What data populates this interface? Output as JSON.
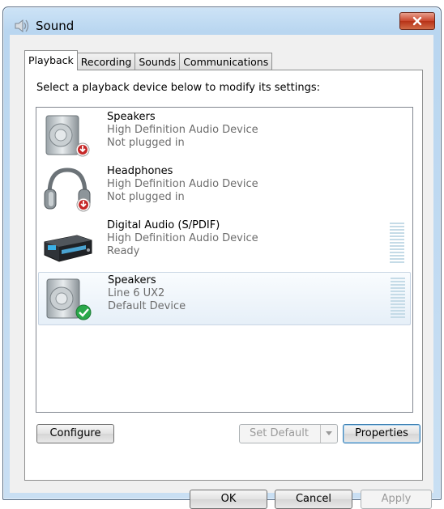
{
  "window": {
    "title": "Sound"
  },
  "tabs": [
    {
      "label": "Playback"
    },
    {
      "label": "Recording"
    },
    {
      "label": "Sounds"
    },
    {
      "label": "Communications"
    }
  ],
  "instruction": "Select a playback device below to modify its settings:",
  "devices": [
    {
      "name": "Speakers",
      "driver": "High Definition Audio Device",
      "status": "Not plugged in",
      "icon": "speaker-unplugged-icon"
    },
    {
      "name": "Headphones",
      "driver": "High Definition Audio Device",
      "status": "Not plugged in",
      "icon": "headphones-unplugged-icon"
    },
    {
      "name": "Digital Audio (S/PDIF)",
      "driver": "High Definition Audio Device",
      "status": "Ready",
      "icon": "digital-audio-device-icon"
    },
    {
      "name": "Speakers",
      "driver": "Line 6 UX2",
      "status": "Default Device",
      "icon": "speaker-default-icon"
    }
  ],
  "buttons": {
    "configure": "Configure",
    "set_default": "Set Default",
    "properties": "Properties",
    "ok": "OK",
    "cancel": "Cancel",
    "apply": "Apply"
  },
  "colors": {
    "accent": "#3c7fb1",
    "default_check": "#2aa84a",
    "unplugged": "#c62828"
  }
}
